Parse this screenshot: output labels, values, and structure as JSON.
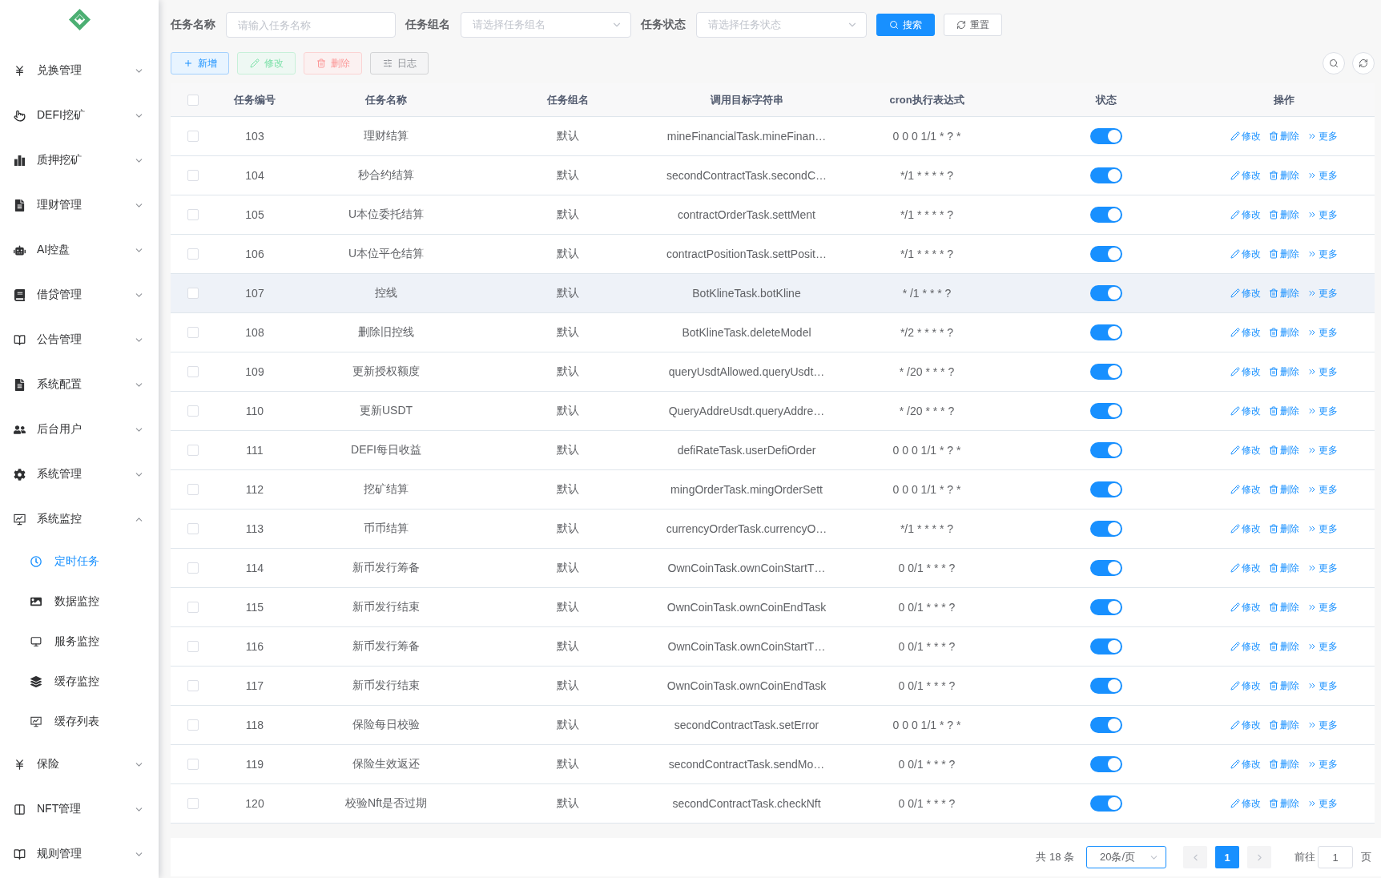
{
  "sidebar": {
    "menu": [
      {
        "label": "兑换管理",
        "expanded": false
      },
      {
        "label": "DEFI挖矿",
        "expanded": false
      },
      {
        "label": "质押挖矿",
        "expanded": false
      },
      {
        "label": "理财管理",
        "expanded": false
      },
      {
        "label": "AI控盘",
        "expanded": false
      },
      {
        "label": "借贷管理",
        "expanded": false
      },
      {
        "label": "公告管理",
        "expanded": false
      },
      {
        "label": "系统配置",
        "expanded": false
      },
      {
        "label": "后台用户",
        "expanded": false
      },
      {
        "label": "系统管理",
        "expanded": false
      },
      {
        "label": "系统监控",
        "expanded": true,
        "children": [
          {
            "label": "定时任务",
            "selected": true
          },
          {
            "label": "数据监控",
            "selected": false
          },
          {
            "label": "服务监控",
            "selected": false
          },
          {
            "label": "缓存监控",
            "selected": false
          },
          {
            "label": "缓存列表",
            "selected": false
          }
        ]
      },
      {
        "label": "保险",
        "expanded": false
      },
      {
        "label": "NFT管理",
        "expanded": false
      },
      {
        "label": "规则管理",
        "expanded": false
      }
    ]
  },
  "search_form": {
    "fields": [
      {
        "kind": "input",
        "label": "任务名称",
        "placeholder": "请输入任务名称"
      },
      {
        "kind": "select",
        "label": "任务组名",
        "placeholder": "请选择任务组名"
      },
      {
        "kind": "select",
        "label": "任务状态",
        "placeholder": "请选择任务状态"
      }
    ],
    "buttons": [
      {
        "kind": "search",
        "label": "搜索"
      },
      {
        "kind": "reset",
        "label": "重置"
      }
    ]
  },
  "toolbar": {
    "buttons": [
      {
        "kind": "add",
        "label": "新增",
        "disabled": false
      },
      {
        "kind": "edit",
        "label": "修改",
        "disabled": true
      },
      {
        "kind": "delete",
        "label": "删除",
        "disabled": true
      },
      {
        "kind": "log",
        "label": "日志",
        "disabled": false
      }
    ]
  },
  "table": {
    "select_all": {
      "checked": false
    },
    "columns": [
      "任务编号",
      "任务名称",
      "任务组名",
      "调用目标字符串",
      "cron执行表达式",
      "状态",
      "操作"
    ],
    "rows": [
      {
        "checked": false,
        "hovered": false,
        "id": "103",
        "name": "理财结算",
        "group": "默认",
        "target": "mineFinancialTask.mineFinan…",
        "cron": "0 0 0 1/1 * ? *",
        "enabled": true,
        "actions": [
          {
            "kind": "edit",
            "label": "修改"
          },
          {
            "kind": "delete",
            "label": "删除"
          },
          {
            "kind": "more",
            "label": "更多"
          }
        ]
      },
      {
        "checked": false,
        "hovered": false,
        "id": "104",
        "name": "秒合约结算",
        "group": "默认",
        "target": "secondContractTask.secondC…",
        "cron": "*/1 * * * * ?",
        "enabled": true,
        "actions": [
          {
            "kind": "edit",
            "label": "修改"
          },
          {
            "kind": "delete",
            "label": "删除"
          },
          {
            "kind": "more",
            "label": "更多"
          }
        ]
      },
      {
        "checked": false,
        "hovered": false,
        "id": "105",
        "name": "U本位委托结算",
        "group": "默认",
        "target": "contractOrderTask.settMent",
        "cron": "*/1 * * * * ?",
        "enabled": true,
        "actions": [
          {
            "kind": "edit",
            "label": "修改"
          },
          {
            "kind": "delete",
            "label": "删除"
          },
          {
            "kind": "more",
            "label": "更多"
          }
        ]
      },
      {
        "checked": false,
        "hovered": false,
        "id": "106",
        "name": "U本位平仓结算",
        "group": "默认",
        "target": "contractPositionTask.settPosit…",
        "cron": "*/1 * * * * ?",
        "enabled": true,
        "actions": [
          {
            "kind": "edit",
            "label": "修改"
          },
          {
            "kind": "delete",
            "label": "删除"
          },
          {
            "kind": "more",
            "label": "更多"
          }
        ]
      },
      {
        "checked": false,
        "hovered": true,
        "id": "107",
        "name": "控线",
        "group": "默认",
        "target": "BotKlineTask.botKline",
        "cron": "* /1 * * * ?",
        "enabled": true,
        "actions": [
          {
            "kind": "edit",
            "label": "修改"
          },
          {
            "kind": "delete",
            "label": "删除"
          },
          {
            "kind": "more",
            "label": "更多"
          }
        ]
      },
      {
        "checked": false,
        "hovered": false,
        "id": "108",
        "name": "删除旧控线",
        "group": "默认",
        "target": "BotKlineTask.deleteModel",
        "cron": "*/2 * * * * ?",
        "enabled": true,
        "actions": [
          {
            "kind": "edit",
            "label": "修改"
          },
          {
            "kind": "delete",
            "label": "删除"
          },
          {
            "kind": "more",
            "label": "更多"
          }
        ]
      },
      {
        "checked": false,
        "hovered": false,
        "id": "109",
        "name": "更新授权额度",
        "group": "默认",
        "target": "queryUsdtAllowed.queryUsdt…",
        "cron": "* /20 * * * ?",
        "enabled": true,
        "actions": [
          {
            "kind": "edit",
            "label": "修改"
          },
          {
            "kind": "delete",
            "label": "删除"
          },
          {
            "kind": "more",
            "label": "更多"
          }
        ]
      },
      {
        "checked": false,
        "hovered": false,
        "id": "110",
        "name": "更新USDT",
        "group": "默认",
        "target": "QueryAddreUsdt.queryAddre…",
        "cron": "* /20 * * * ?",
        "enabled": true,
        "actions": [
          {
            "kind": "edit",
            "label": "修改"
          },
          {
            "kind": "delete",
            "label": "删除"
          },
          {
            "kind": "more",
            "label": "更多"
          }
        ]
      },
      {
        "checked": false,
        "hovered": false,
        "id": "111",
        "name": "DEFI每日收益",
        "group": "默认",
        "target": "defiRateTask.userDefiOrder",
        "cron": "0 0 0 1/1 * ? *",
        "enabled": true,
        "actions": [
          {
            "kind": "edit",
            "label": "修改"
          },
          {
            "kind": "delete",
            "label": "删除"
          },
          {
            "kind": "more",
            "label": "更多"
          }
        ]
      },
      {
        "checked": false,
        "hovered": false,
        "id": "112",
        "name": "挖矿结算",
        "group": "默认",
        "target": "mingOrderTask.mingOrderSett",
        "cron": "0 0 0 1/1 * ? *",
        "enabled": true,
        "actions": [
          {
            "kind": "edit",
            "label": "修改"
          },
          {
            "kind": "delete",
            "label": "删除"
          },
          {
            "kind": "more",
            "label": "更多"
          }
        ]
      },
      {
        "checked": false,
        "hovered": false,
        "id": "113",
        "name": "币币结算",
        "group": "默认",
        "target": "currencyOrderTask.currencyO…",
        "cron": "*/1 * * * * ?",
        "enabled": true,
        "actions": [
          {
            "kind": "edit",
            "label": "修改"
          },
          {
            "kind": "delete",
            "label": "删除"
          },
          {
            "kind": "more",
            "label": "更多"
          }
        ]
      },
      {
        "checked": false,
        "hovered": false,
        "id": "114",
        "name": "新币发行筹备",
        "group": "默认",
        "target": "OwnCoinTask.ownCoinStartT…",
        "cron": "0 0/1 * * * ?",
        "enabled": true,
        "actions": [
          {
            "kind": "edit",
            "label": "修改"
          },
          {
            "kind": "delete",
            "label": "删除"
          },
          {
            "kind": "more",
            "label": "更多"
          }
        ]
      },
      {
        "checked": false,
        "hovered": false,
        "id": "115",
        "name": "新币发行结束",
        "group": "默认",
        "target": "OwnCoinTask.ownCoinEndTask",
        "cron": "0 0/1 * * * ?",
        "enabled": true,
        "actions": [
          {
            "kind": "edit",
            "label": "修改"
          },
          {
            "kind": "delete",
            "label": "删除"
          },
          {
            "kind": "more",
            "label": "更多"
          }
        ]
      },
      {
        "checked": false,
        "hovered": false,
        "id": "116",
        "name": "新币发行筹备",
        "group": "默认",
        "target": "OwnCoinTask.ownCoinStartT…",
        "cron": "0 0/1 * * * ?",
        "enabled": true,
        "actions": [
          {
            "kind": "edit",
            "label": "修改"
          },
          {
            "kind": "delete",
            "label": "删除"
          },
          {
            "kind": "more",
            "label": "更多"
          }
        ]
      },
      {
        "checked": false,
        "hovered": false,
        "id": "117",
        "name": "新币发行结束",
        "group": "默认",
        "target": "OwnCoinTask.ownCoinEndTask",
        "cron": "0 0/1 * * * ?",
        "enabled": true,
        "actions": [
          {
            "kind": "edit",
            "label": "修改"
          },
          {
            "kind": "delete",
            "label": "删除"
          },
          {
            "kind": "more",
            "label": "更多"
          }
        ]
      },
      {
        "checked": false,
        "hovered": false,
        "id": "118",
        "name": "保险每日校验",
        "group": "默认",
        "target": "secondContractTask.setError",
        "cron": "0 0 0 1/1 * ? *",
        "enabled": true,
        "actions": [
          {
            "kind": "edit",
            "label": "修改"
          },
          {
            "kind": "delete",
            "label": "删除"
          },
          {
            "kind": "more",
            "label": "更多"
          }
        ]
      },
      {
        "checked": false,
        "hovered": false,
        "id": "119",
        "name": "保险生效返还",
        "group": "默认",
        "target": "secondContractTask.sendMo…",
        "cron": "0 0/1 * * * ?",
        "enabled": true,
        "actions": [
          {
            "kind": "edit",
            "label": "修改"
          },
          {
            "kind": "delete",
            "label": "删除"
          },
          {
            "kind": "more",
            "label": "更多"
          }
        ]
      },
      {
        "checked": false,
        "hovered": false,
        "id": "120",
        "name": "校验Nft是否过期",
        "group": "默认",
        "target": "secondContractTask.checkNft",
        "cron": "0 0/1 * * * ?",
        "enabled": true,
        "actions": [
          {
            "kind": "edit",
            "label": "修改"
          },
          {
            "kind": "delete",
            "label": "删除"
          },
          {
            "kind": "more",
            "label": "更多"
          }
        ]
      }
    ]
  },
  "pagination": {
    "total": "共 18 条",
    "page_size": "20条/页",
    "prev": {
      "disabled": true
    },
    "pages": [
      {
        "label": "1",
        "selected": true
      }
    ],
    "next": {
      "disabled": true
    },
    "jump_label": "前往",
    "jump_value": "1",
    "jump_suffix": "页"
  }
}
